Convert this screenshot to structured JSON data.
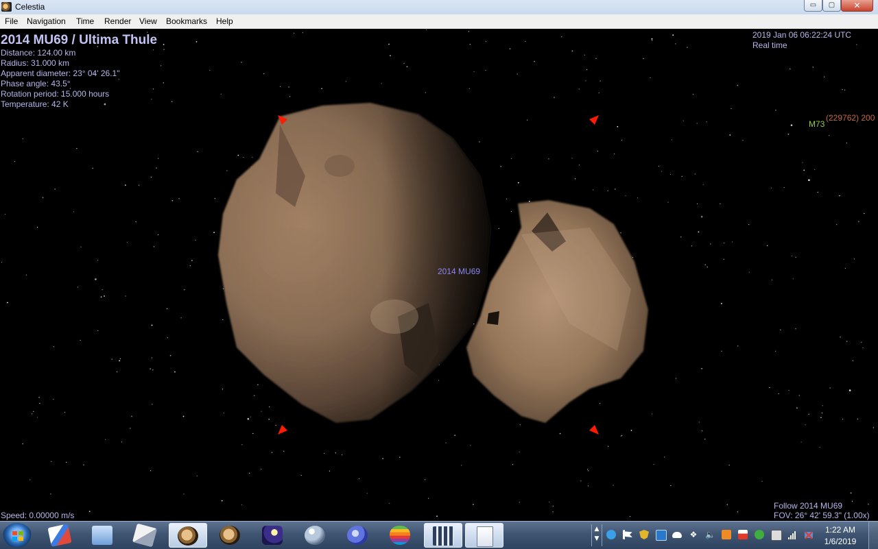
{
  "window": {
    "title": "Celestia",
    "min_label": "▭",
    "max_label": "▢",
    "close_label": "✕"
  },
  "menu": [
    {
      "label": "File"
    },
    {
      "label": "Navigation"
    },
    {
      "label": "Time"
    },
    {
      "label": "Render"
    },
    {
      "label": "View"
    },
    {
      "label": "Bookmarks"
    },
    {
      "label": "Help"
    }
  ],
  "overlay": {
    "object_title": "2014 MU69 /  Ultima Thule",
    "info": [
      "Distance: 124.00 km",
      "Radius: 31.000 km",
      "Apparent diameter: 23° 04' 26.1\"",
      "Phase angle: 43.5°",
      "Rotation period: 15.000 hours",
      "Temperature: 42 K"
    ],
    "datetime": "2019 Jan 06 06:22:24 UTC",
    "time_mode": "Real time",
    "speed": "Speed: 0.00000 m/s",
    "follow": "Follow 2014 MU69",
    "fov": "FOV: 26° 42' 59.3\" (1.00x)"
  },
  "labels": {
    "center_object": "2014 MU69",
    "m73": "M73",
    "asteroid": "(229762) 200"
  },
  "colors": {
    "overlay_text": "#b7b7ec",
    "selection_marker": "#ff1a00",
    "label_mu69": "#8a86f2",
    "label_m73": "#8fcf48",
    "label_asteroid": "#c56a3a"
  },
  "taskbar": {
    "clock_time": "1:22 AM",
    "clock_date": "1/6/2019",
    "apps": [
      {
        "icon": "paint-icon"
      },
      {
        "icon": "monitor-icon"
      },
      {
        "icon": "tools-icon"
      },
      {
        "icon": "celestia-icon"
      },
      {
        "icon": "celestia-icon-2"
      },
      {
        "icon": "moon-night-icon"
      },
      {
        "icon": "crystal-ball-icon"
      },
      {
        "icon": "gear-ball-icon"
      },
      {
        "icon": "apple-icon"
      },
      {
        "icon": "calculator-icon"
      },
      {
        "icon": "document-icon"
      }
    ],
    "tray_icons": [
      "cloud-app-icon",
      "flag-icon",
      "shield-icon",
      "network-box-icon",
      "onedrive-icon",
      "dropbox-icon",
      "volume-icon",
      "java-icon",
      "power-icon",
      "security-icon",
      "box-icon",
      "signal-icon",
      "network-warning-icon"
    ]
  }
}
